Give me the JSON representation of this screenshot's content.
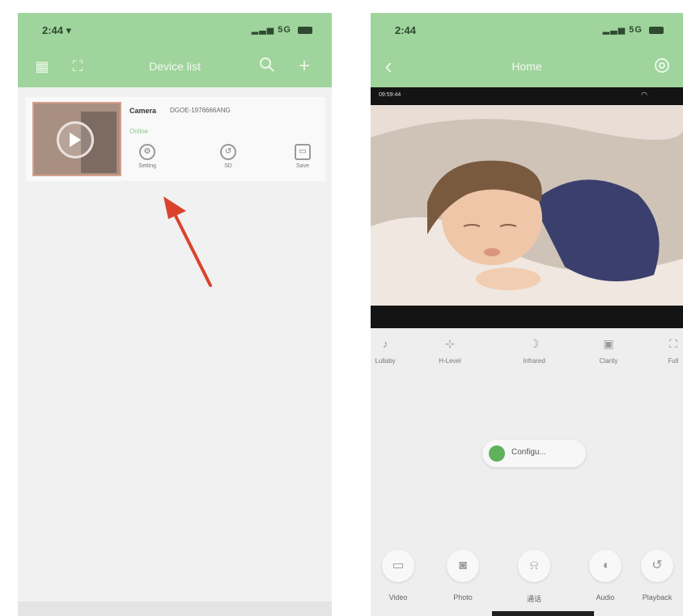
{
  "left_screen": {
    "status": {
      "time": "2:44 ▾",
      "network": "5G"
    },
    "nav": {
      "title": "Device list",
      "search_icon": "search-icon",
      "add_icon": "plus-icon"
    },
    "device": {
      "name": "Camera",
      "id": "DGOE-1976666ANG",
      "status": "Online",
      "actions": [
        {
          "label": "Setting",
          "icon": "gear-icon"
        },
        {
          "label": "SD",
          "icon": "history-icon"
        },
        {
          "label": "Save",
          "icon": "folder-icon"
        }
      ]
    }
  },
  "right_screen": {
    "status": {
      "time": "2:44",
      "network": "5G"
    },
    "nav": {
      "title": "Home",
      "back_icon": "chevron-left-icon",
      "settings_icon": "gear-icon"
    },
    "video": {
      "timestamp": "09:59:44"
    },
    "controls": [
      {
        "label": "Lullaby",
        "icon": "music-icon"
      },
      {
        "label": "H-Level",
        "icon": "level-icon"
      },
      {
        "label": "Infrared",
        "icon": "moon-icon"
      },
      {
        "label": "Clarity",
        "icon": "hd-icon"
      },
      {
        "label": "Full",
        "icon": "fullscreen-icon"
      }
    ],
    "config_button": {
      "label": "Configu..."
    },
    "bottom_actions": [
      {
        "label": "Video",
        "icon": "video-icon"
      },
      {
        "label": "Photo",
        "icon": "camera-icon"
      },
      {
        "label": "通话",
        "icon": "bell-icon"
      },
      {
        "label": "Audio",
        "icon": "speaker-icon"
      },
      {
        "label": "Playback",
        "icon": "history-icon"
      }
    ]
  },
  "colors": {
    "header_green": "#9fd49c",
    "accent_green": "#5fb25b",
    "arrow_red": "#d9432c"
  }
}
